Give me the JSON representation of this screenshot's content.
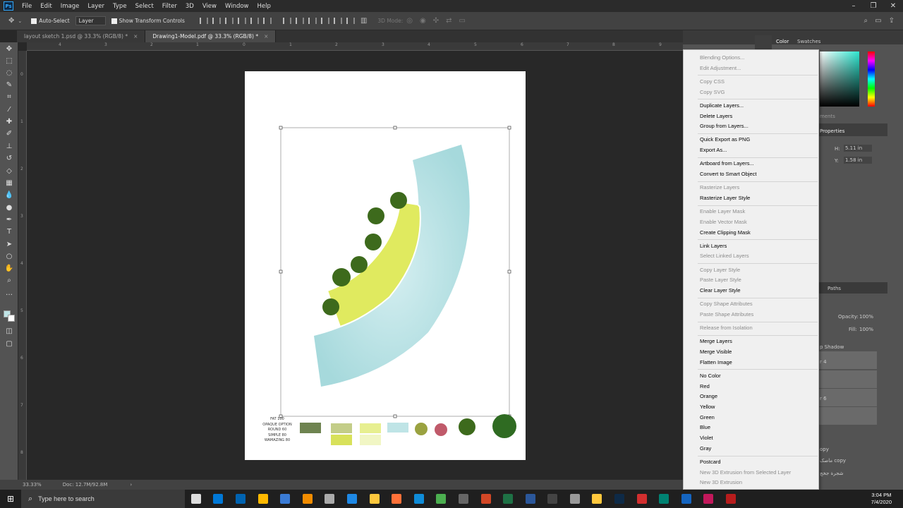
{
  "app": {
    "logo": "Ps"
  },
  "menubar": {
    "items": [
      "File",
      "Edit",
      "Image",
      "Layer",
      "Type",
      "Select",
      "Filter",
      "3D",
      "View",
      "Window",
      "Help"
    ]
  },
  "optionsbar": {
    "auto_select_label": "Auto-Select",
    "auto_select_target": "Layer",
    "show_transform_label": "Show Transform Controls",
    "mode_3d_label": "3D Mode:"
  },
  "tabs": [
    {
      "label": "layout sketch 1.psd @ 33.3% (RGB/8) *",
      "close": "×"
    },
    {
      "label": "Drawing1-Model.pdf @ 33.3% (RGB/8) *",
      "close": "×"
    }
  ],
  "ruler_top": [
    "4",
    "3",
    "2",
    "1",
    "0",
    "1",
    "2",
    "3",
    "4",
    "5",
    "6",
    "7",
    "8",
    "9",
    "10"
  ],
  "ruler_left": [
    "0",
    "1",
    "2",
    "3",
    "4",
    "5",
    "6",
    "7",
    "8"
  ],
  "document": {
    "legend_lines": [
      "FAT 100",
      "OPAQUE OPTION",
      "ROUND 60",
      "SIMPLE 80",
      "WAMAZING 80"
    ],
    "swatches": [
      "#6e8350",
      "#c3cd88",
      "#e7ef90",
      "#bfe4e6",
      "#d8e15a",
      "#f1f6c4"
    ]
  },
  "statusbar": {
    "zoom": "33.33%",
    "doc_info": "Doc: 12.7M/92.8M"
  },
  "panels": {
    "color_tab": "Color",
    "swatches_tab": "Swatches",
    "adjustments_tab": "ments",
    "properties_label": "Properties",
    "w_label": "H:",
    "w_value": "5.11 in",
    "y_label": "Y:",
    "y_value": "1.58 in",
    "paths_tab": "Paths",
    "opacity_label": "Opacity:",
    "opacity_value": "100%",
    "fill_label": "Fill:",
    "fill_value": "100%",
    "drop_shadow": "p Shadow",
    "layer_a": "r 4",
    "layer_b": "r 6",
    "layer_copy": "opy",
    "layer_copy2": "ماصک copy",
    "layer_arabic": "شجرة جخج"
  },
  "context_menu": {
    "items": [
      {
        "label": "Blending Options...",
        "disabled": true
      },
      {
        "label": "Edit Adjustment...",
        "disabled": true
      },
      {
        "label": "Copy CSS",
        "disabled": true
      },
      {
        "label": "Copy SVG",
        "disabled": true
      },
      {
        "label": "Duplicate Layers...",
        "disabled": false
      },
      {
        "label": "Delete Layers",
        "disabled": false
      },
      {
        "label": "Group from Layers...",
        "disabled": false
      },
      {
        "label": "Quick Export as PNG",
        "disabled": false
      },
      {
        "label": "Export As...",
        "disabled": false
      },
      {
        "label": "Artboard from Layers...",
        "disabled": false
      },
      {
        "label": "Convert to Smart Object",
        "disabled": false
      },
      {
        "label": "Rasterize Layers",
        "disabled": true
      },
      {
        "label": "Rasterize Layer Style",
        "disabled": false
      },
      {
        "label": "Enable Layer Mask",
        "disabled": true
      },
      {
        "label": "Enable Vector Mask",
        "disabled": true
      },
      {
        "label": "Create Clipping Mask",
        "disabled": false
      },
      {
        "label": "Link Layers",
        "disabled": false
      },
      {
        "label": "Select Linked Layers",
        "disabled": true
      },
      {
        "label": "Copy Layer Style",
        "disabled": true
      },
      {
        "label": "Paste Layer Style",
        "disabled": true
      },
      {
        "label": "Clear Layer Style",
        "disabled": false
      },
      {
        "label": "Copy Shape Attributes",
        "disabled": true
      },
      {
        "label": "Paste Shape Attributes",
        "disabled": true
      },
      {
        "label": "Release from Isolation",
        "disabled": true
      },
      {
        "label": "Merge Layers",
        "disabled": false
      },
      {
        "label": "Merge Visible",
        "disabled": false
      },
      {
        "label": "Flatten Image",
        "disabled": false
      },
      {
        "label": "No Color",
        "disabled": false
      },
      {
        "label": "Red",
        "disabled": false
      },
      {
        "label": "Orange",
        "disabled": false
      },
      {
        "label": "Yellow",
        "disabled": false
      },
      {
        "label": "Green",
        "disabled": false
      },
      {
        "label": "Blue",
        "disabled": false
      },
      {
        "label": "Violet",
        "disabled": false
      },
      {
        "label": "Gray",
        "disabled": false
      },
      {
        "label": "Postcard",
        "disabled": false
      },
      {
        "label": "New 3D Extrusion from Selected Layer",
        "disabled": true
      },
      {
        "label": "New 3D Extrusion",
        "disabled": true
      }
    ]
  },
  "taskbar": {
    "search_placeholder": "Type here to search",
    "time": "3:04 PM",
    "date": "7/4/2020",
    "lang": "ع",
    "icons": [
      "task-view-icon",
      "store-icon",
      "mail-icon",
      "files-icon",
      "media-icon",
      "vlc-icon",
      "chrome-dev-icon",
      "b-icon",
      "folder-icon",
      "firefox-icon",
      "edge-icon",
      "chrome-icon",
      "calculator-icon",
      "powerpoint-icon",
      "excel-icon",
      "word-icon",
      "steam-icon",
      "tool-icon",
      "folder2-icon",
      "photoshop-icon",
      "acrobat-icon",
      "app-icon",
      "app2-icon",
      "app3-icon",
      "app4-icon"
    ]
  }
}
